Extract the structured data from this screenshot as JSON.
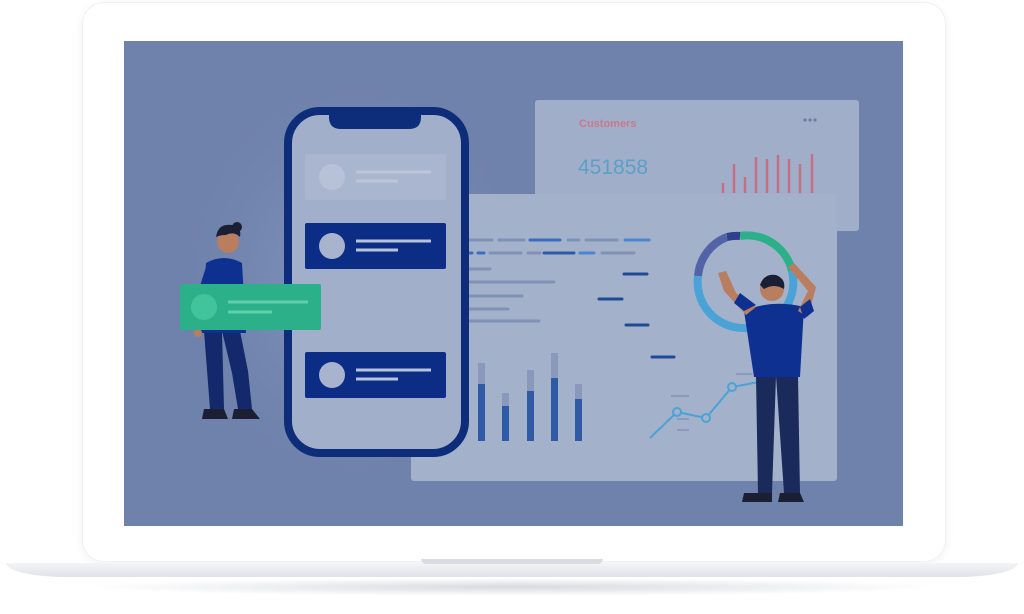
{
  "customers_card": {
    "label": "Customers",
    "value": "451858",
    "menu_icon": "more-horizontal-icon",
    "sparkline_color": "#c56f82"
  },
  "colors": {
    "screen_bg": "#6f82ab",
    "phone_frame": "#0d2d7a",
    "card_dark": "#0b2d86",
    "accent_teal": "#2bb08a",
    "chart_blue": "#2e5aa6",
    "line_blue": "#4aa3d6"
  },
  "illustration": {
    "left_person": "person-holding-card",
    "right_person": "person-reaching-chart"
  }
}
